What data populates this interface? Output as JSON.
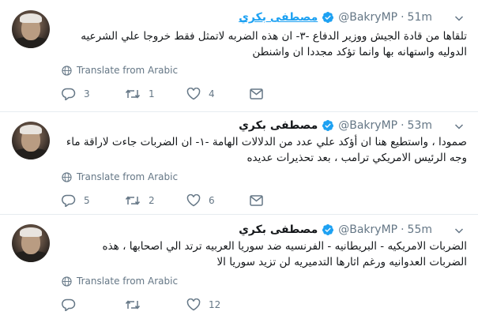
{
  "tweets": [
    {
      "name": "مصطفى بكري",
      "handle": "@BakryMP",
      "time": "51m",
      "text": "تلقاها من قادة الجيش ووزير الدفاع -٣- ان هذه الضربه لاتمثل فقط خروجا علي الشرعيه الدوليه واستهانه بها وانما تؤكد مجددا ان واشنطن",
      "translate_label": "Translate from Arabic",
      "replies": "3",
      "retweets": "1",
      "likes": "4"
    },
    {
      "name": "مصطفى بكري",
      "handle": "@BakryMP",
      "time": "53m",
      "text": "صمودا ، واستطيع هنا ان أؤكد علي عدد من الدلالات الهامة -١- ان الضربات جاءت لاراقة ماء وجه الرئيس الامريكي ترامب ، بعد تحذيرات عديده",
      "translate_label": "Translate from Arabic",
      "replies": "5",
      "retweets": "2",
      "likes": "6"
    },
    {
      "name": "مصطفى بكري",
      "handle": "@BakryMP",
      "time": "55m",
      "text": "الضربات الامريكيه - البريطانيه - الفرنسيه ضد سوريا العربيه ترتد الي اصحابها ، هذه الضربات العدوانيه ورغم اثارها التدميريه لن تزيد سوريا الا",
      "translate_label": "Translate from Arabic",
      "replies": "",
      "retweets": "",
      "likes": "12"
    }
  ],
  "colors": {
    "accent": "#1da1f2",
    "muted": "#657786",
    "divider": "#e6ecf0"
  },
  "icons": [
    "verified-icon",
    "chevron-down-icon",
    "globe-icon",
    "reply-icon",
    "retweet-icon",
    "like-icon",
    "message-icon"
  ]
}
